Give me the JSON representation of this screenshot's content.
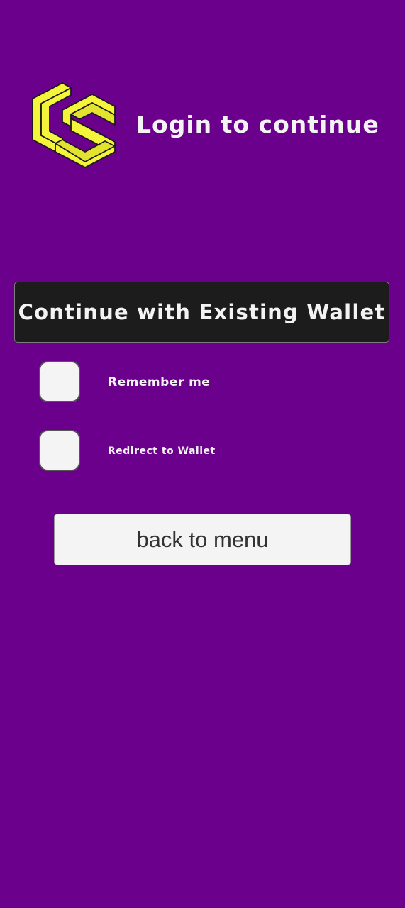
{
  "colors": {
    "background": "#6a008c",
    "logo_fill": "#f4f43a",
    "wallet_button_bg": "#1c1c1c",
    "light_control_bg": "#f4f4f4"
  },
  "header": {
    "logo_icon": "cube-logo-icon",
    "title": "Login to continue"
  },
  "wallet_button": {
    "label": "Continue with Existing Wallet"
  },
  "options": {
    "remember": {
      "label": "Remember me",
      "checked": false
    },
    "redirect": {
      "label": "Redirect to Wallet",
      "checked": false
    }
  },
  "back_button": {
    "label": "back to menu"
  }
}
